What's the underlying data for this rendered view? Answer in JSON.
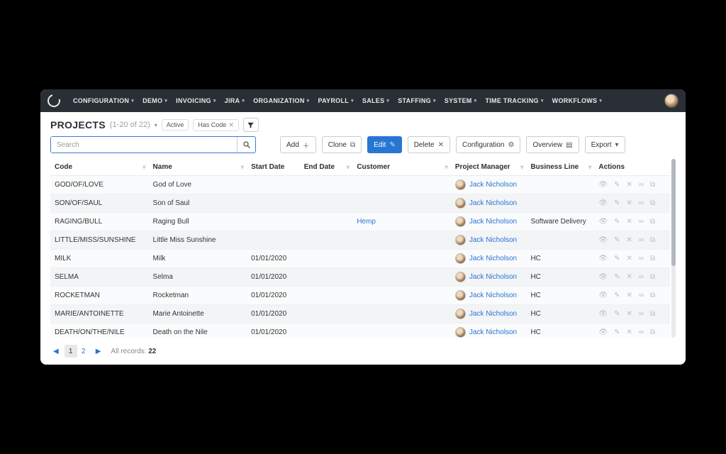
{
  "nav": {
    "items": [
      "CONFIGURATION",
      "DEMO",
      "INVOICING",
      "JIRA",
      "ORGANIZATION",
      "PAYROLL",
      "SALES",
      "STAFFING",
      "SYSTEM",
      "TIME TRACKING",
      "WORKFLOWS"
    ]
  },
  "header": {
    "title": "PROJECTS",
    "subtitle": "(1-20 of 22)",
    "chips": [
      {
        "label": "Active",
        "closable": false
      },
      {
        "label": "Has Code",
        "closable": true
      }
    ]
  },
  "search": {
    "placeholder": "Search"
  },
  "toolbar": {
    "add": "Add",
    "clone": "Clone",
    "edit": "Edit",
    "delete": "Delete",
    "configuration": "Configuration",
    "overview": "Overview",
    "export": "Export"
  },
  "columns": {
    "code": "Code",
    "name": "Name",
    "start": "Start Date",
    "end": "End Date",
    "customer": "Customer",
    "pm": "Project Manager",
    "bline": "Business Line",
    "actions": "Actions"
  },
  "rows": [
    {
      "code": "GOD/OF/LOVE",
      "name": "God of Love",
      "start": "",
      "end": "",
      "customer": "",
      "pm": "Jack Nicholson",
      "bline": ""
    },
    {
      "code": "SON/OF/SAUL",
      "name": "Son of Saul",
      "start": "",
      "end": "",
      "customer": "",
      "pm": "Jack Nicholson",
      "bline": ""
    },
    {
      "code": "RAGING/BULL",
      "name": "Raging Bull",
      "start": "",
      "end": "",
      "customer": "Hemp",
      "pm": "Jack Nicholson",
      "bline": "Software Delivery"
    },
    {
      "code": "LITTLE/MISS/SUNSHINE",
      "name": "Little Miss Sunshine",
      "start": "",
      "end": "",
      "customer": "",
      "pm": "Jack Nicholson",
      "bline": ""
    },
    {
      "code": "MILK",
      "name": "Milk",
      "start": "01/01/2020",
      "end": "",
      "customer": "",
      "pm": "Jack Nicholson",
      "bline": "HC"
    },
    {
      "code": "SELMA",
      "name": "Selma",
      "start": "01/01/2020",
      "end": "",
      "customer": "",
      "pm": "Jack Nicholson",
      "bline": "HC"
    },
    {
      "code": "ROCKETMAN",
      "name": "Rocketman",
      "start": "01/01/2020",
      "end": "",
      "customer": "",
      "pm": "Jack Nicholson",
      "bline": "HC"
    },
    {
      "code": "MARIE/ANTOINETTE",
      "name": "Marie Antoinette",
      "start": "01/01/2020",
      "end": "",
      "customer": "",
      "pm": "Jack Nicholson",
      "bline": "HC"
    },
    {
      "code": "DEATH/ON/THE/NILE",
      "name": "Death on the Nile",
      "start": "01/01/2020",
      "end": "",
      "customer": "",
      "pm": "Jack Nicholson",
      "bline": "HC"
    }
  ],
  "pager": {
    "pages": [
      "1",
      "2"
    ],
    "active": "1",
    "all_label": "All records:",
    "all_count": "22"
  }
}
